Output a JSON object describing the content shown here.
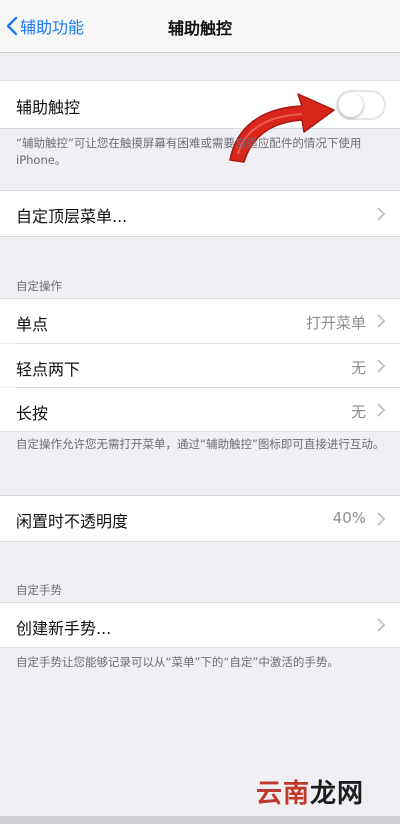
{
  "nav": {
    "back_label": "辅助功能",
    "title": "辅助触控"
  },
  "assistive_touch": {
    "label": "辅助触控",
    "enabled": false,
    "note": "“辅助触控”可让您在触摸屏幕有困难或需要自适应配件的情况下使用 iPhone。"
  },
  "top_menu": {
    "label": "自定顶层菜单..."
  },
  "custom_actions": {
    "header": "自定操作",
    "rows": [
      {
        "label": "单点",
        "value": "打开菜单"
      },
      {
        "label": "轻点两下",
        "value": "无"
      },
      {
        "label": "长按",
        "value": "无"
      }
    ],
    "note": "自定操作允许您无需打开菜单，通过“辅助触控”图标即可直接进行互动。"
  },
  "idle_opacity": {
    "label": "闲置时不透明度",
    "value": "40%"
  },
  "custom_gestures": {
    "header": "自定手势",
    "create_label": "创建新手势...",
    "note": "自定手势让您能够记录可以从“菜单”下的“自定”中激活的手势。"
  },
  "watermark": {
    "part1": "云南",
    "part2": "龙网"
  },
  "colors": {
    "accent": "#1a7cf5",
    "background": "#efeff4",
    "arrow": "#d8261c"
  }
}
